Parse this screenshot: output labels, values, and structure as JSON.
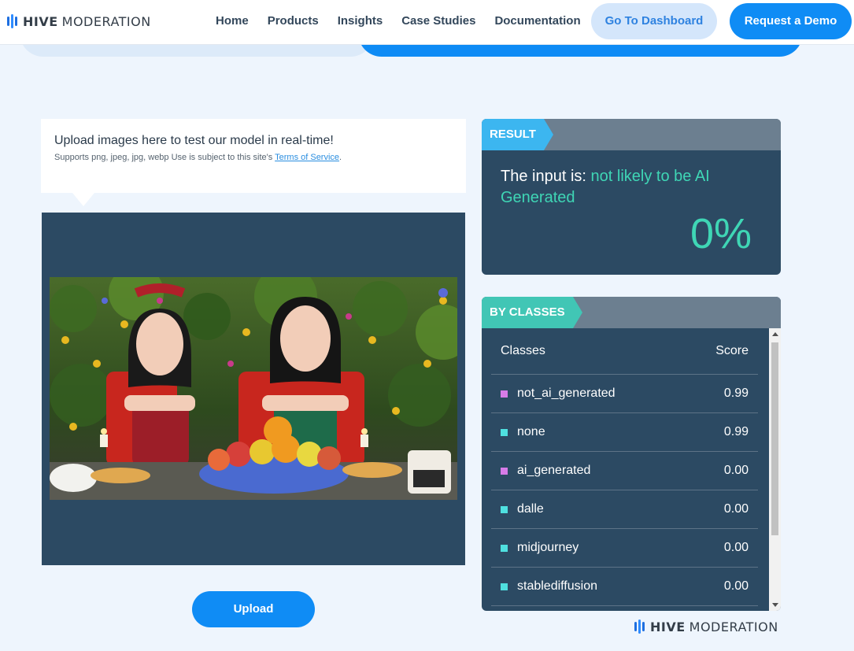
{
  "header": {
    "logo_bold": "HIVE",
    "logo_light": "MODERATION",
    "nav": [
      "Home",
      "Products",
      "Insights",
      "Case Studies",
      "Documentation"
    ],
    "dashboard_button": "Go To Dashboard",
    "demo_button": "Request a Demo"
  },
  "upload": {
    "title": "Upload images here to test our model in real-time!",
    "subtitle": "Supports png, jpeg, jpg, webp Use is subject to this site's",
    "terms_link": "Terms of Service",
    "period": ".",
    "button": "Upload"
  },
  "result": {
    "tag": "RESULT",
    "prefix": "The input is:",
    "verdict": "not likely to be AI Generated",
    "percent": "0%"
  },
  "classes": {
    "tag": "BY CLASSES",
    "col_class": "Classes",
    "col_score": "Score",
    "rows": [
      {
        "name": "not_ai_generated",
        "score": "0.99",
        "color": "#d77ce8"
      },
      {
        "name": "none",
        "score": "0.99",
        "color": "#4fe0e0"
      },
      {
        "name": "ai_generated",
        "score": "0.00",
        "color": "#d77ce8"
      },
      {
        "name": "dalle",
        "score": "0.00",
        "color": "#4fe0e0"
      },
      {
        "name": "midjourney",
        "score": "0.00",
        "color": "#4fe0e0"
      },
      {
        "name": "stablediffusion",
        "score": "0.00",
        "color": "#4fe0e0"
      }
    ]
  },
  "footer": {
    "logo_bold": "HIVE",
    "logo_light": "MODERATION"
  },
  "colors": {
    "accent_blue": "#0f8cf5",
    "teal": "#3fd6b5",
    "panel": "#2c4a63"
  }
}
